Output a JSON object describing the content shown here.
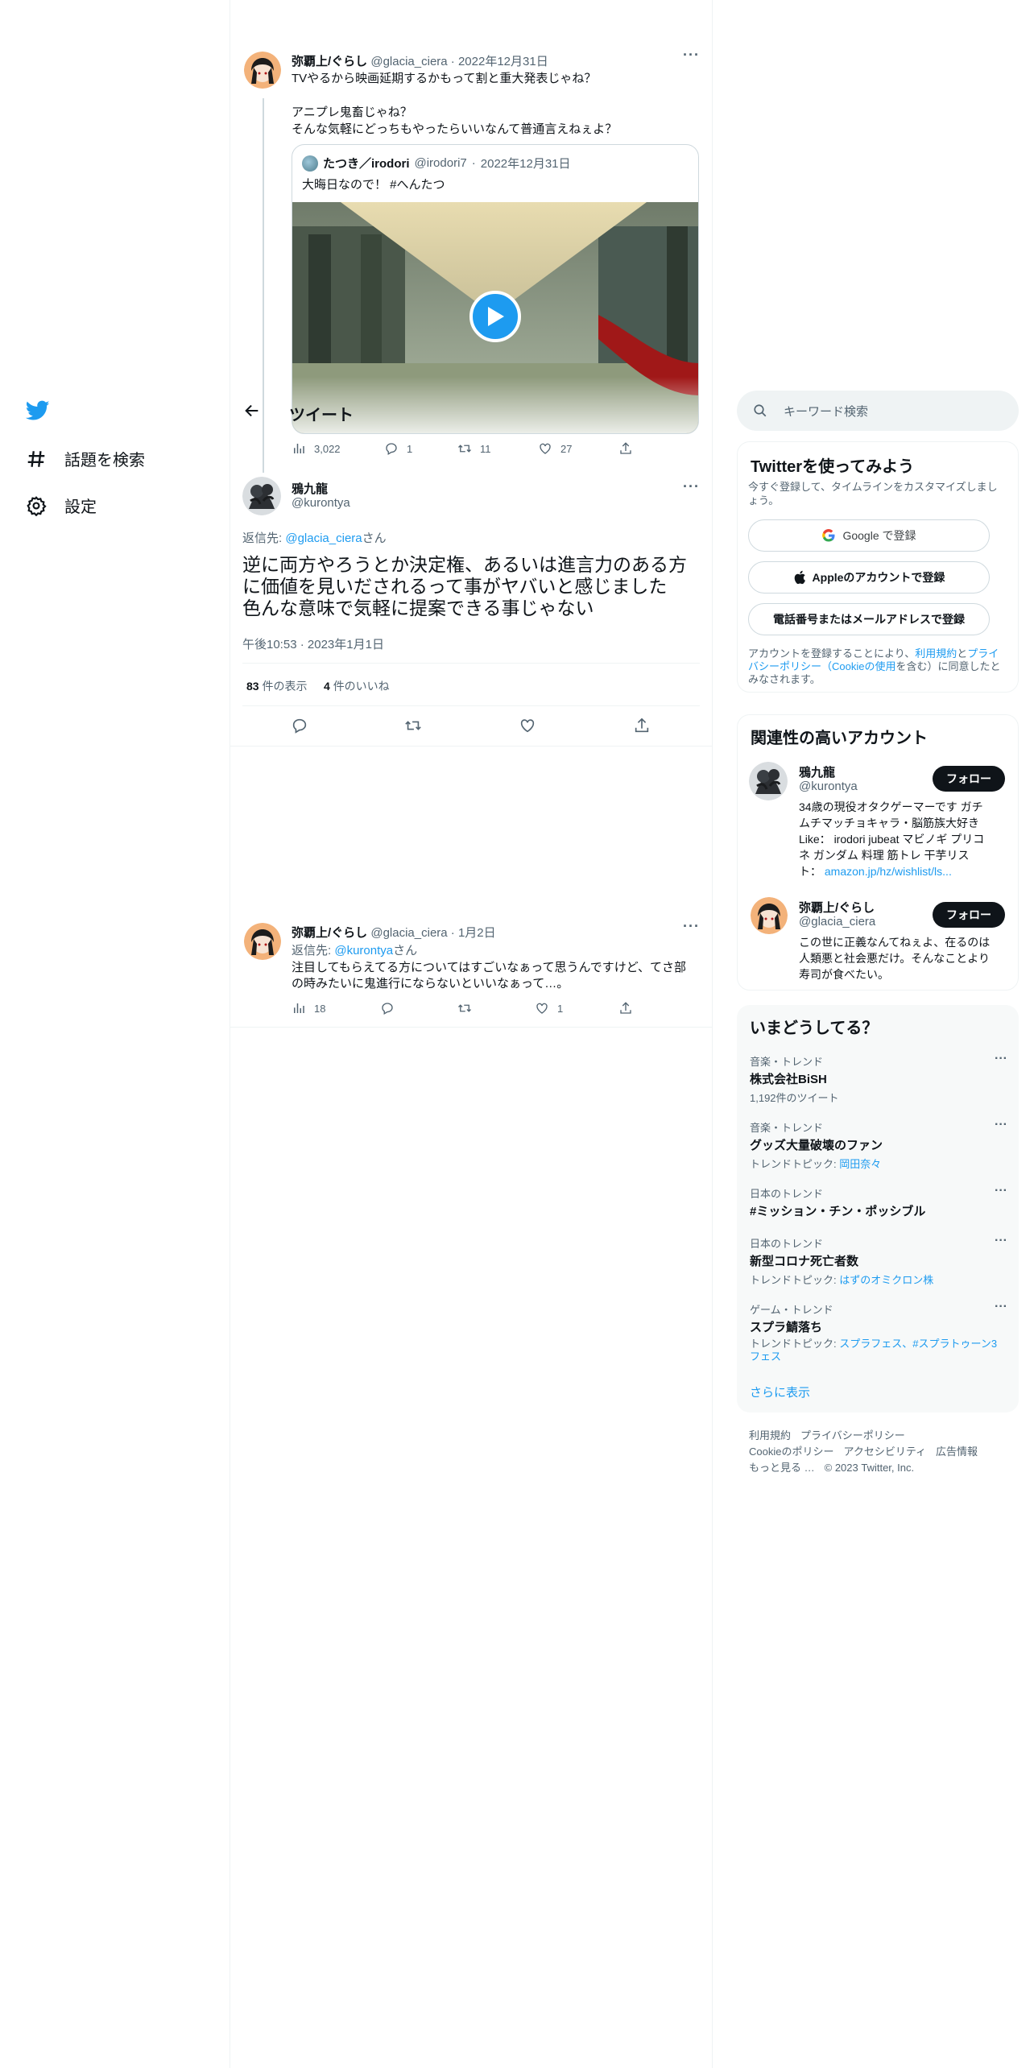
{
  "nav": {
    "explore": "話題を検索",
    "settings": "設定"
  },
  "header": {
    "title": "ツイート"
  },
  "tweet1": {
    "name": "弥覇上/ぐらし",
    "handle": "@glacia_ciera",
    "date": "2022年12月31日",
    "line1": "TVやるから映画延期するかもって割と重大発表じゃね？",
    "line2": "アニプレ鬼畜じゃね？",
    "line3": "そんな気軽にどっちもやったらいいなんて普通言えねぇよ？",
    "quote": {
      "name": "たつき／irodori",
      "handle": "@irodori7",
      "date": "2022年12月31日",
      "text": "大晦日なので！ #へんたつ"
    },
    "views": "3,022",
    "replies": "1",
    "retweets": "11",
    "likes": "27"
  },
  "main_tweet": {
    "name": "鴉九龍",
    "handle": "@kurontya",
    "reply_prefix": "返信先: ",
    "reply_to": "@glacia_ciera",
    "reply_suffix": "さん",
    "line1": "逆に両方やろうとか決定権、あるいは進言力のある方",
    "line2": "に価値を見いだされるって事がヤバいと感じました",
    "line3": "色んな意味で気軽に提案できる事じゃない",
    "time": "午後10:53",
    "date": "2023年1月1日",
    "views_count": "83",
    "views_label": "件の表示",
    "likes_count": "4",
    "likes_label": "件のいいね"
  },
  "reply_tweet": {
    "name": "弥覇上/ぐらし",
    "handle": "@glacia_ciera",
    "date": "1月2日",
    "reply_prefix": "返信先: ",
    "reply_to": "@kurontya",
    "reply_suffix": "さん",
    "line1": "注目してもらえてる方についてはすごいなぁって思うんですけど、てさ部",
    "line2": "の時みたいに鬼進行にならないといいなぁって…。",
    "views": "18",
    "likes": "1"
  },
  "search": {
    "placeholder": "キーワード検索"
  },
  "signup": {
    "title": "Twitterを使ってみよう",
    "desc": "今すぐ登録して、タイムラインをカスタマイズしましょう。",
    "google": "Google で登録",
    "apple": "Appleのアカウントで登録",
    "phone": "電話番号またはメールアドレスで登録",
    "terms_1": "アカウントを登録することにより、",
    "terms_link1": "利用規約",
    "terms_2": "と",
    "terms_link2": "プライバシーポリシー（Cookieの使用",
    "terms_3": "を含む）に同意したとみなされます。"
  },
  "related": {
    "title": "関連性の高いアカウント",
    "follow_label": "フォロー",
    "accounts": [
      {
        "name": "鴉九龍",
        "handle": "@kurontya",
        "bio1": "34歳の現役オタクゲーマーです ガチ",
        "bio2": "ムチマッチョキャラ・脳筋族大好き",
        "bio3": "Like： irodori jubeat マビノギ プリコ",
        "bio4": "ネ ガンダム 料理 筋トレ 干芋リス",
        "bio5": "ト：",
        "bio_link": "amazon.jp/hz/wishlist/ls..."
      },
      {
        "name": "弥覇上/ぐらし",
        "handle": "@glacia_ciera",
        "bio1": "この世に正義なんてねぇよ、在るのは",
        "bio2": "人類悪と社会悪だけ。そんなことより",
        "bio3": "寿司が食べたい。"
      }
    ]
  },
  "trends": {
    "title": "いまどうしてる？",
    "items": [
      {
        "category": "音楽・トレンド",
        "name": "株式会社BiSH",
        "sub": "1,192件のツイート"
      },
      {
        "category": "音楽・トレンド",
        "name": "グッズ大量破壊のファン",
        "sub_prefix": "トレンドトピック: ",
        "sub_link": "岡田奈々"
      },
      {
        "category": "日本のトレンド",
        "name": "#ミッション・チン・ポッシブル"
      },
      {
        "category": "日本のトレンド",
        "name": "新型コロナ死亡者数",
        "sub_prefix": "トレンドトピック: ",
        "sub_link": "はずのオミクロン株"
      },
      {
        "category": "ゲーム・トレンド",
        "name": "スプラ鯖落ち",
        "sub_prefix": "トレンドトピック: ",
        "sub_link": "スプラフェス、#スプラトゥーン3",
        "sub_link2": "フェス"
      }
    ],
    "more": "さらに表示"
  },
  "footer": {
    "terms": "利用規約",
    "privacy": "プライバシーポリシー",
    "cookie": "Cookieのポリシー",
    "access": "アクセシビリティ",
    "ads": "広告情報",
    "more": "もっと見る …",
    "copyright": "© 2023 Twitter, Inc."
  },
  "colors": {
    "accent": "#1d9bf0",
    "text": "#0f1419",
    "muted": "#536471"
  }
}
